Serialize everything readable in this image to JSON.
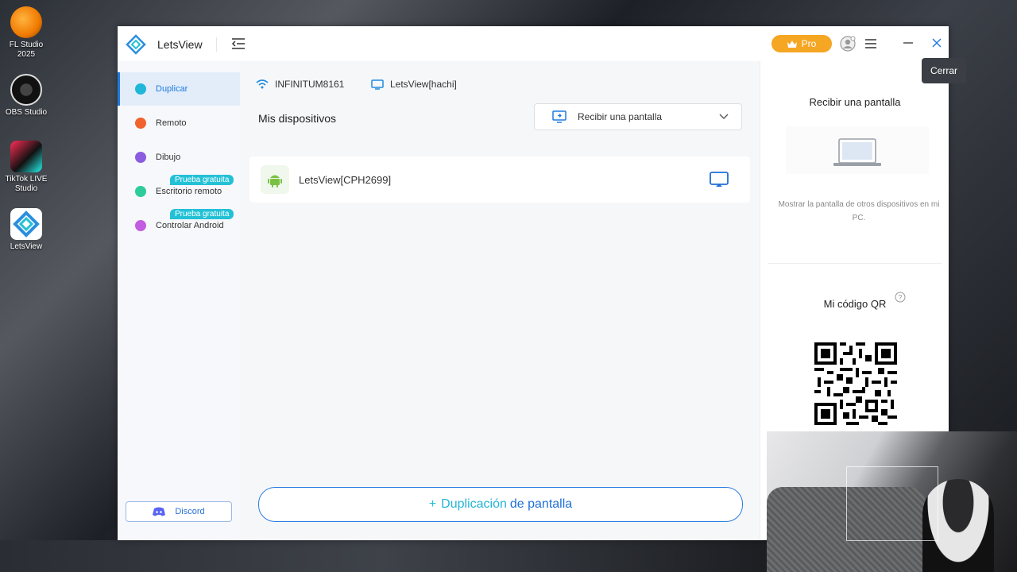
{
  "desktop": {
    "icons": [
      {
        "label": "FL Studio 2025"
      },
      {
        "label": "OBS Studio"
      },
      {
        "label": "TikTok LIVE Studio"
      },
      {
        "label": "LetsView"
      }
    ]
  },
  "window": {
    "title": "LetsView",
    "pro_label": "Pro",
    "close_tooltip": "Cerrar"
  },
  "sidebar": {
    "items": [
      {
        "label": "Duplicar",
        "color": "#1fb6d8"
      },
      {
        "label": "Remoto",
        "color": "#f2622e"
      },
      {
        "label": "Dibujo",
        "color": "#8a5ce0"
      },
      {
        "label": "Escritorio remoto",
        "color": "#2ecc9b",
        "badge": "Prueba gratuita"
      },
      {
        "label": "Controlar Android",
        "color": "#c25ce0",
        "badge": "Prueba gratuita"
      }
    ],
    "discord_label": "Discord"
  },
  "main": {
    "wifi_name": "INFINITUM8161",
    "pc_name": "LetsView[hachi]",
    "section_title": "Mis dispositivos",
    "dropdown_label": "Recibir una pantalla",
    "devices": [
      {
        "name": "LetsView[CPH2699]"
      }
    ],
    "dup_button": {
      "plus": "+",
      "part1": "Duplicación",
      "part2": "de pantalla"
    }
  },
  "right_panel": {
    "title": "Recibir una pantalla",
    "description": "Mostrar la pantalla de otros dispositivos en mi PC.",
    "qr_title": "Mi código QR"
  },
  "colors": {
    "accent": "#1e7be0",
    "pro": "#f5a623",
    "teal": "#23c1d6"
  }
}
